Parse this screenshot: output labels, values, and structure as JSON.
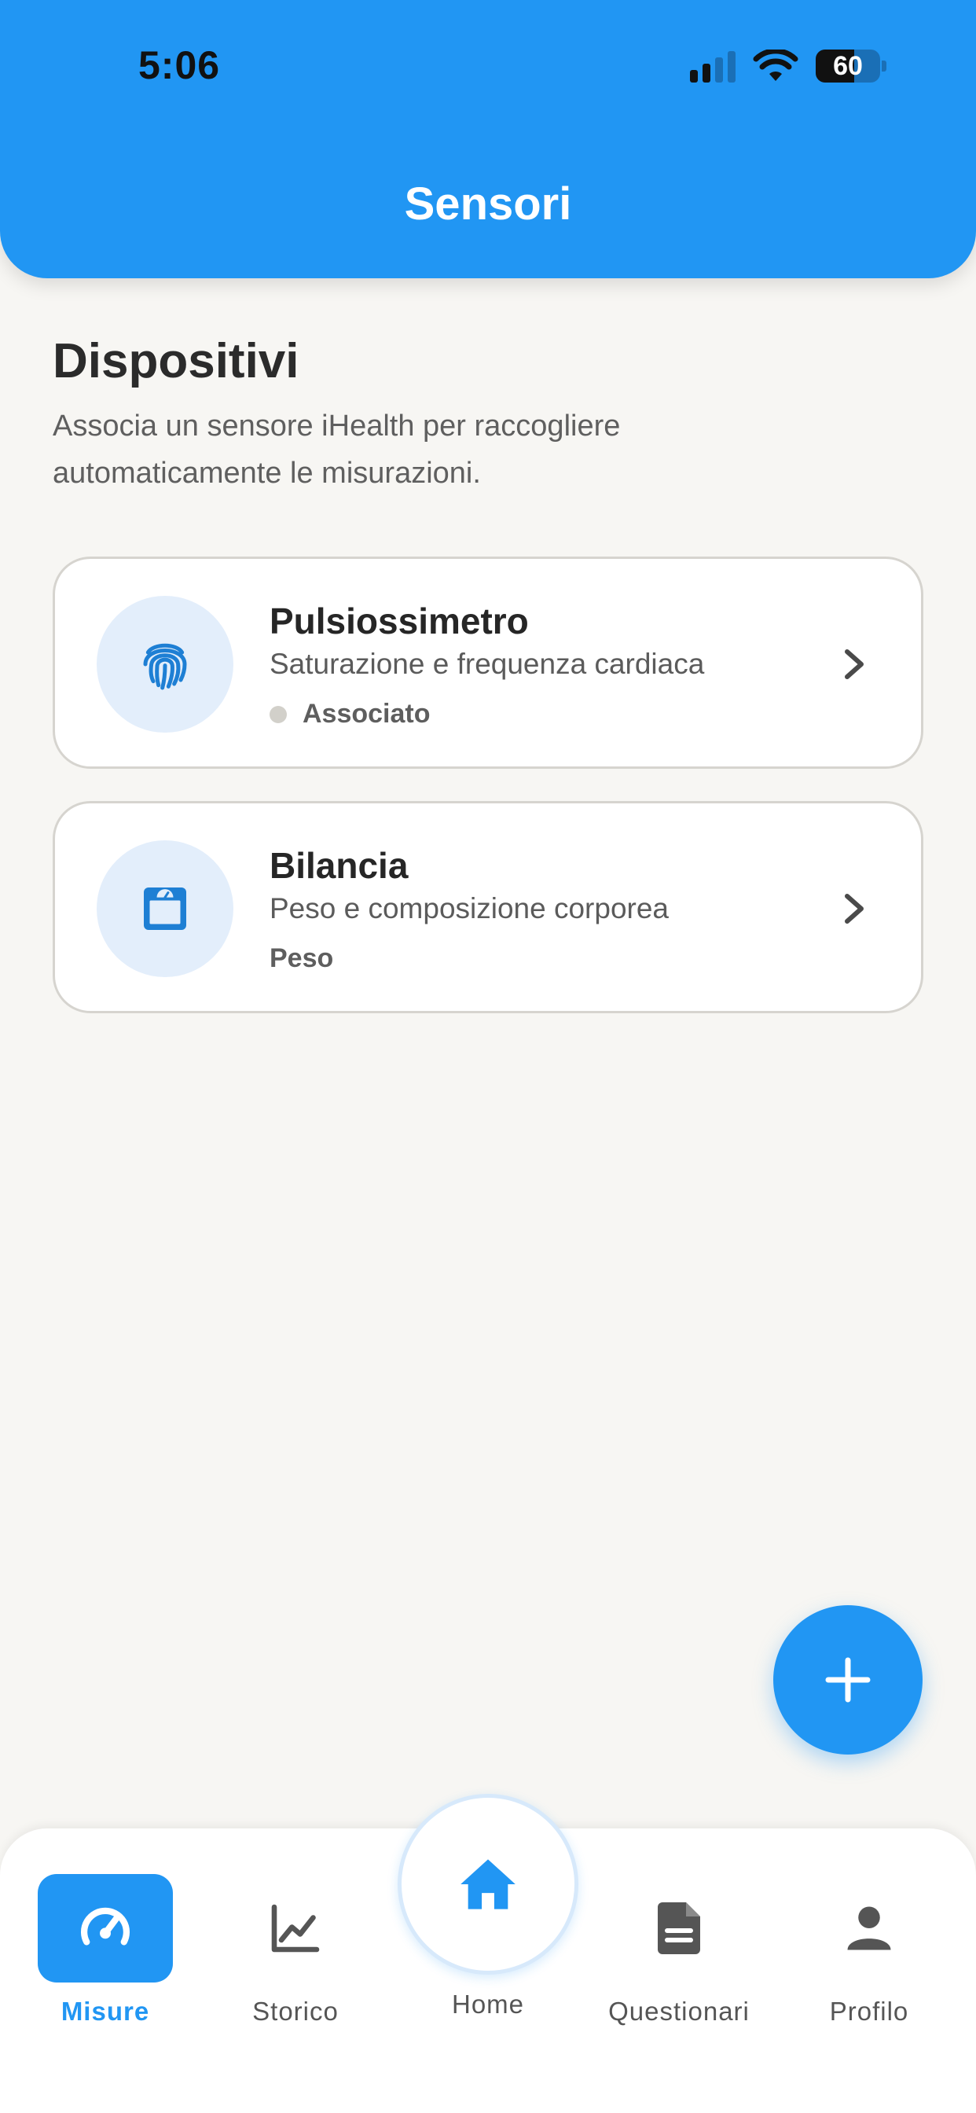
{
  "status_bar": {
    "time": "5:06",
    "battery": "60"
  },
  "header": {
    "title": "Sensori"
  },
  "section": {
    "title": "Dispositivi",
    "subtitle": "Associa un sensore iHealth per raccogliere automaticamente le misurazioni."
  },
  "devices": [
    {
      "name": "Pulsiossimetro",
      "description": "Saturazione e frequenza cardiaca",
      "status": "Associato",
      "icon": "fingerprint-icon"
    },
    {
      "name": "Bilancia",
      "description": "Peso e composizione corporea",
      "status": "Peso",
      "icon": "scale-icon"
    }
  ],
  "nav": {
    "items": [
      {
        "label": "Misure",
        "icon": "speedometer-icon",
        "active": true
      },
      {
        "label": "Storico",
        "icon": "chart-line-icon"
      },
      {
        "label": "Home",
        "icon": "home-icon"
      },
      {
        "label": "Questionari",
        "icon": "document-icon"
      },
      {
        "label": "Profilo",
        "icon": "person-icon"
      }
    ]
  },
  "colors": {
    "primary": "#2196f3",
    "background": "#f7f6f3",
    "icon_bg": "#e3eefb"
  }
}
